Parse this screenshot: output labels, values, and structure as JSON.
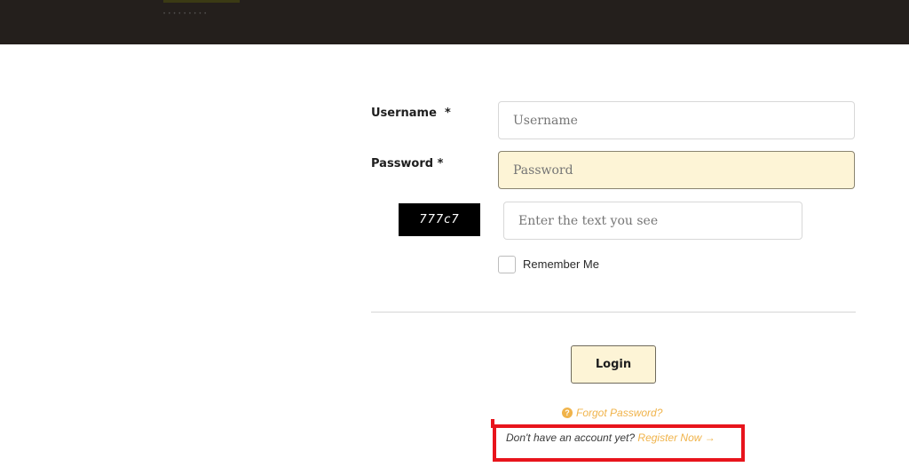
{
  "header": {
    "background_color": "#241f1c",
    "blurred_text": "• • • • • • • • •"
  },
  "form": {
    "username": {
      "label": "Username",
      "required_marker": "*",
      "placeholder": "Username",
      "value": ""
    },
    "password": {
      "label": "Password",
      "required_marker": "*",
      "placeholder": "Password",
      "value": "",
      "focused": true
    },
    "captcha": {
      "image_text": "777c7",
      "placeholder": "Enter the text you see",
      "value": ""
    },
    "remember_me": {
      "label": "Remember Me",
      "checked": false
    },
    "login_button": {
      "label": "Login"
    }
  },
  "links": {
    "forgot_password": "Forgot Password?",
    "forgot_icon": "question-circle-icon",
    "no_account_text": "Don't have an account yet?",
    "register_label": "Register Now",
    "register_arrow": "→"
  },
  "colors": {
    "accent": "#f0b34a",
    "input_focus_bg": "#fdf4d6",
    "highlight": "#e8141c"
  }
}
